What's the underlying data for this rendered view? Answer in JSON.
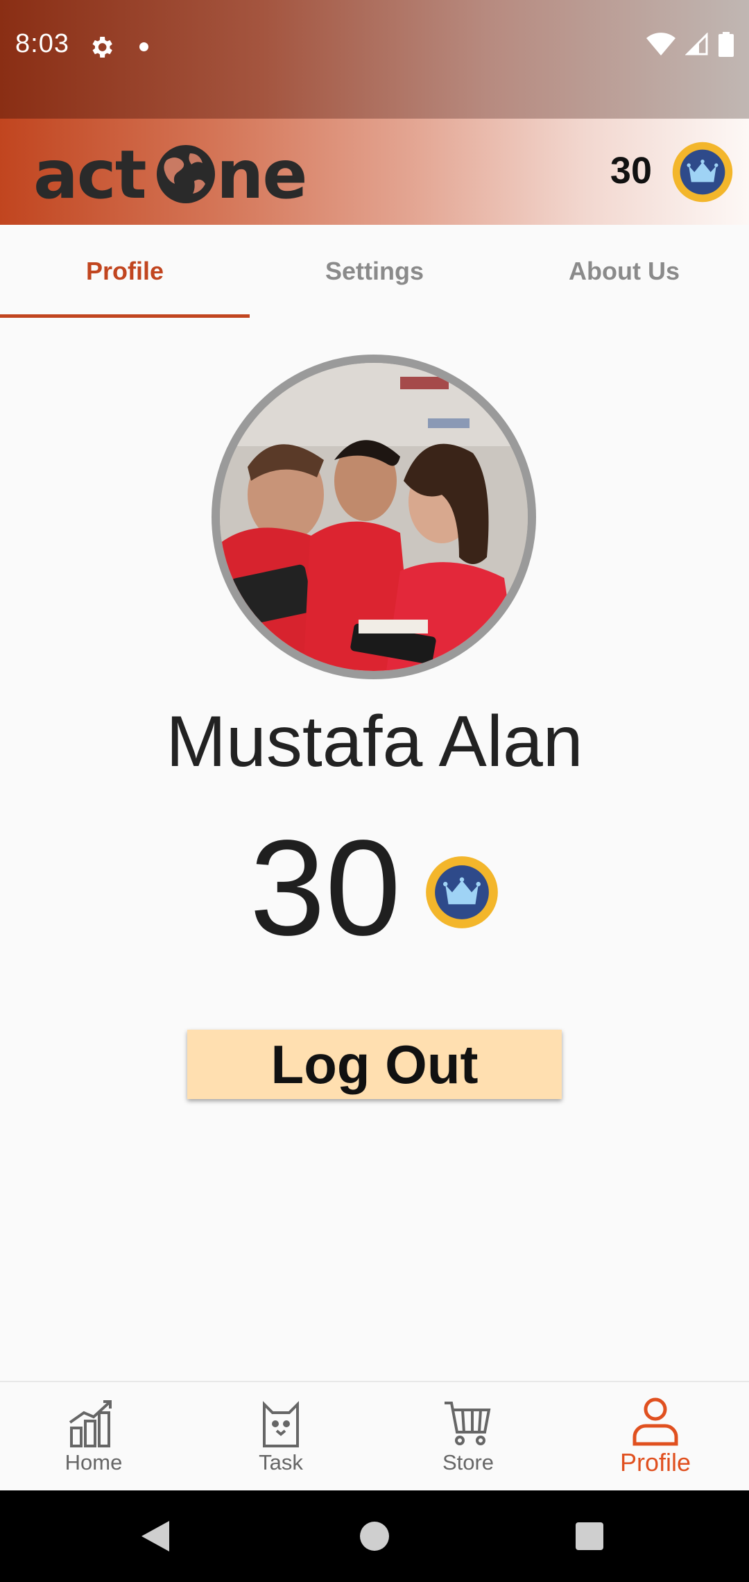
{
  "status_bar": {
    "time": "8:03"
  },
  "header": {
    "logo_text": "actone",
    "coins": "30"
  },
  "tabs": [
    {
      "label": "Profile",
      "active": true
    },
    {
      "label": "Settings",
      "active": false
    },
    {
      "label": "About Us",
      "active": false
    }
  ],
  "profile": {
    "name": "Mustafa Alan",
    "points": "30",
    "logout_label": "Log Out"
  },
  "bottom_nav": [
    {
      "label": "Home",
      "icon": "chart-growth-icon"
    },
    {
      "label": "Task",
      "icon": "cat-task-icon"
    },
    {
      "label": "Store",
      "icon": "cart-icon"
    },
    {
      "label": "Profile",
      "icon": "person-icon",
      "active": true
    }
  ],
  "colors": {
    "accent": "#c1451f",
    "nav_active": "#e0501f",
    "button_bg": "#ffdfb0",
    "crown_gold": "#f3b62b",
    "crown_blue": "#2e4a8a"
  }
}
